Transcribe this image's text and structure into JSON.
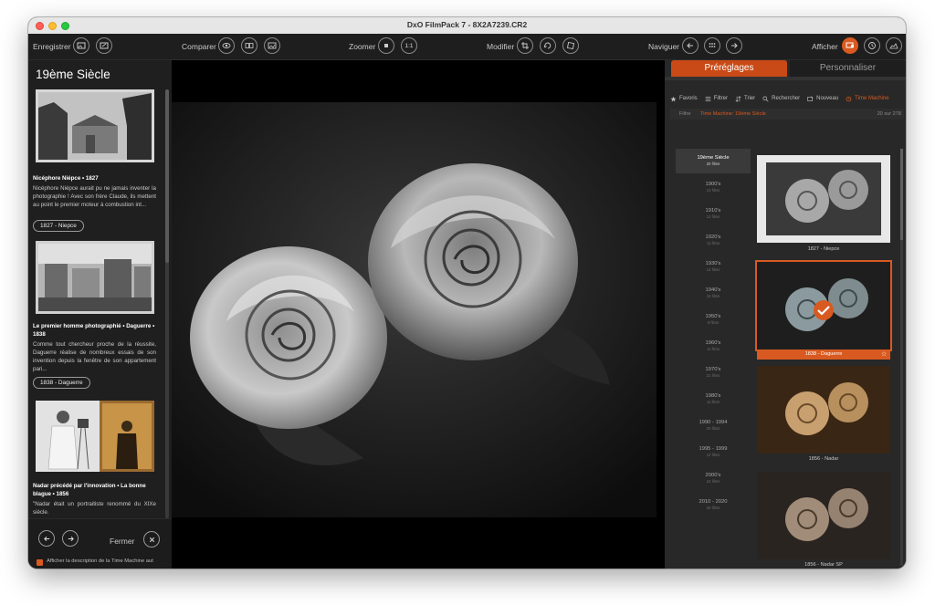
{
  "window": {
    "title": "DxO FilmPack 7 - 8X2A7239.CR2"
  },
  "toolbar": {
    "save": "Enregistrer",
    "compare": "Comparer",
    "zoom": "Zoomer",
    "zoom_ratio": "1:1",
    "modify": "Modifier",
    "navigate": "Naviguer",
    "display": "Afficher"
  },
  "left_panel": {
    "title": "19ème Siècle",
    "entries": [
      {
        "title": "Nicéphore Niépce • 1827",
        "desc": "Nicéphore Niépce aurait pu ne jamais inventer la photographie ! Avec son frère Claude, ils mettent au point le premier moteur à combustion int...",
        "pill": "1827 - Niepce"
      },
      {
        "title": "Le premier homme photographié • Daguerre • 1838",
        "desc": "Comme tout chercheur proche de la réussite, Daguerre réalise de nombreux essais de son invention depuis la fenêtre de son appartement pari...",
        "pill": "1838 - Daguerre"
      },
      {
        "title": "Nadar précédé par l'innovation • La bonne blague • 1856",
        "desc": "\"Nadar était un portraitiste renommé du XIXe siècle."
      }
    ],
    "footer": {
      "close": "Fermer",
      "checkbox_label": "Afficher la description de la Time Machine aut"
    }
  },
  "right_panel": {
    "tabs": [
      "Préréglages",
      "Personnaliser"
    ],
    "tools": [
      "Favoris",
      "Filtrer",
      "Trier",
      "Rechercher",
      "Nouveau",
      "Time Machine"
    ],
    "filter": {
      "label": "Filtre",
      "value": "Time Machine: 19ème Siècle",
      "count": "20 sur 278"
    },
    "decades": [
      {
        "name": "19ème Siècle",
        "count": "20 films"
      },
      {
        "name": "1900's",
        "count": "13 films"
      },
      {
        "name": "1910's",
        "count": "13 films"
      },
      {
        "name": "1920's",
        "count": "11 films"
      },
      {
        "name": "1930's",
        "count": "14 films"
      },
      {
        "name": "1940's",
        "count": "15 films"
      },
      {
        "name": "1950's",
        "count": "8 films"
      },
      {
        "name": "1960's",
        "count": "11 films"
      },
      {
        "name": "1970's",
        "count": "21 films"
      },
      {
        "name": "1980's",
        "count": "11 films"
      },
      {
        "name": "1990 - 1994",
        "count": "20 films"
      },
      {
        "name": "1995 - 1999",
        "count": "12 films"
      },
      {
        "name": "2000's",
        "count": "24 films"
      },
      {
        "name": "2010 - 2020",
        "count": "20 films"
      }
    ],
    "thumbnails": [
      "1827 - Niepce",
      "1838 - Daguerre",
      "1856 - Nadar",
      "1856 - Nadar SP"
    ]
  },
  "colors": {
    "accent": "#d85a20",
    "panel": "#282828",
    "background": "#000000"
  }
}
